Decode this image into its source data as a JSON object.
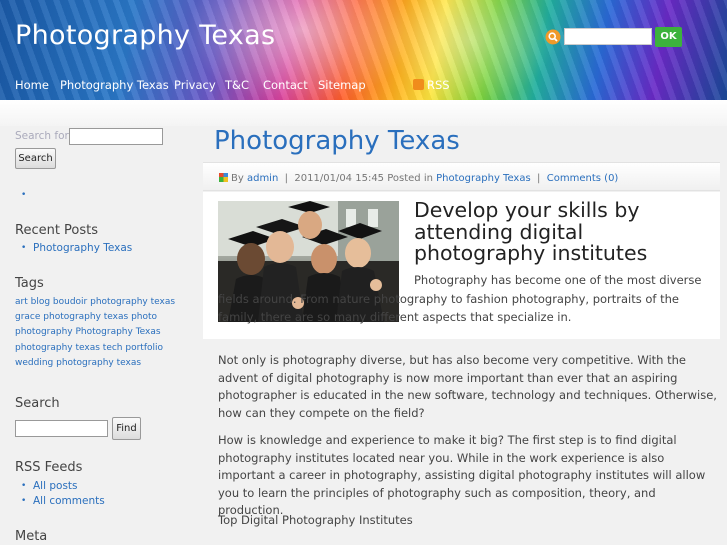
{
  "header": {
    "site_title": "Photography Texas",
    "search_button": "OK",
    "nav": [
      "Home",
      "Photography Texas",
      "Privacy",
      "T&C",
      "Contact",
      "Sitemap"
    ],
    "rss_label": "RSS"
  },
  "sidebar": {
    "search_for_label": "Search for:",
    "search_button": "Search",
    "recent_posts_heading": "Recent Posts",
    "recent_posts": [
      "Photography Texas"
    ],
    "tags_heading": "Tags",
    "tags_text": "art blog boudoir photography texas grace photography texas photo photography Photography Texas photography texas tech portfolio wedding photography texas",
    "search_heading": "Search",
    "find_button": "Find",
    "rss_heading": "RSS Feeds",
    "rss_links": [
      "All posts",
      "All comments"
    ],
    "meta_heading": "Meta"
  },
  "main": {
    "page_title": "Photography Texas",
    "meta": {
      "by": "By",
      "author": "admin",
      "datetime": "2011/01/04 15:45",
      "posted_in": "Posted in",
      "category": "Photography Texas",
      "comments": "Comments (0)"
    },
    "headline": "Develop your skills by attending digital photography institutes",
    "intro": "Photography has become one of the most diverse fields around. From nature photography to fashion photography, portraits of the family, there are so many different aspects that specialize in.",
    "paragraphs": [
      "Not only is photography diverse, but has also become very competitive. With the advent of digital photography is now more important than ever that an aspiring photographer is educated in the new software, technology and techniques. Otherwise, how can they compete on the field?",
      "How is knowledge and experience to make it big? The first step is to find digital photography institutes located near you. While in the work experience is also important a career in photography, assisting digital photography institutes will allow you to learn the principles of photography such as composition, theory, and production.",
      "Top Digital Photography Institutes"
    ]
  }
}
